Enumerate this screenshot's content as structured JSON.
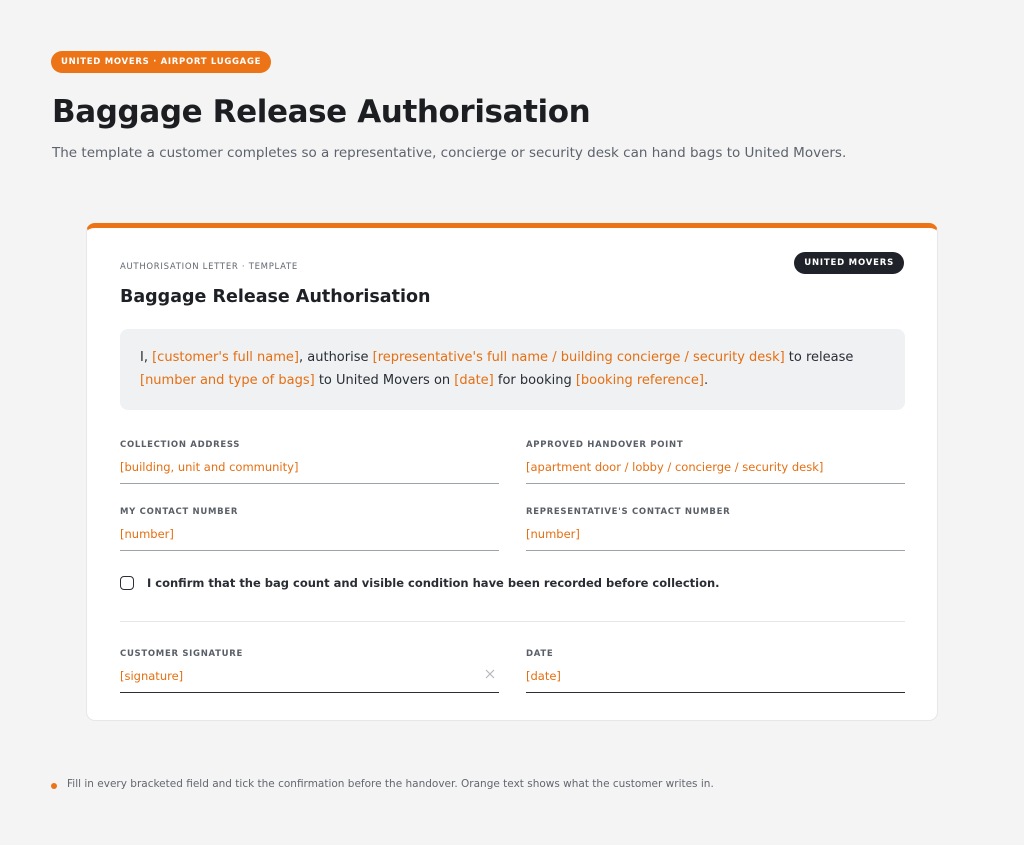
{
  "header": {
    "tag": "UNITED MOVERS · AIRPORT LUGGAGE",
    "title": "Baggage Release Authorisation",
    "subtitle": "The template a customer completes so a representative, concierge or security desk can hand bags to United Movers."
  },
  "card": {
    "eyebrow": "AUTHORISATION LETTER · TEMPLATE",
    "badge": "UNITED MOVERS",
    "title": "Baggage Release Authorisation",
    "accent_color": "#ec7316",
    "statement": {
      "t1": "I, ",
      "customer_name": "[customer's full name]",
      "t2": ", authorise ",
      "representative": "[representative's full name / building concierge / security desk]",
      "t3": " to release ",
      "bags": "[number and type of bags]",
      "t4": " to United Movers on ",
      "date": "[date]",
      "t5": " for booking ",
      "booking": "[booking reference]",
      "t6": "."
    },
    "fields": {
      "collection_address": {
        "label": "COLLECTION ADDRESS",
        "value": "[building, unit and community]"
      },
      "handover_point": {
        "label": "APPROVED HANDOVER POINT",
        "value": "[apartment door / lobby / concierge / security desk]"
      },
      "my_contact": {
        "label": "MY CONTACT NUMBER",
        "value": "[number]"
      },
      "rep_contact": {
        "label": "REPRESENTATIVE'S CONTACT NUMBER",
        "value": "[number]"
      },
      "signature": {
        "label": "CUSTOMER SIGNATURE",
        "value": "[signature]",
        "clear_icon": "close-icon"
      },
      "date": {
        "label": "DATE",
        "value": "[date]"
      }
    },
    "confirmation": {
      "label": "I confirm that the bag count and visible condition have been recorded before collection.",
      "checked": false
    }
  },
  "footer": {
    "note": "Fill in every bracketed field and tick the confirmation before the handover. Orange text shows what the customer writes in."
  }
}
